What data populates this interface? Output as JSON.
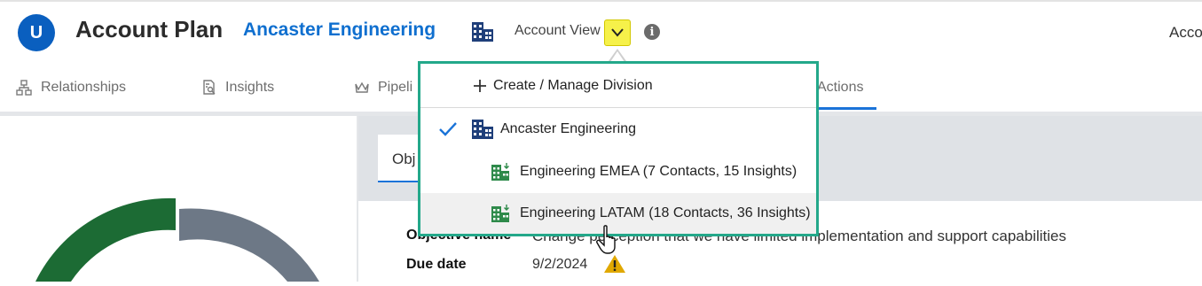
{
  "header": {
    "logo_letter": "U",
    "title": "Account Plan",
    "account_name": "Ancaster Engineering",
    "account_view_label": "Account View",
    "info_symbol": "i",
    "right_truncated_text": "Acco"
  },
  "tabs": [
    {
      "label": "Relationships",
      "icon": "hierarchy-icon"
    },
    {
      "label": "Insights",
      "icon": "insights-icon"
    },
    {
      "label": "Pipeli",
      "icon": "crown-icon"
    },
    {
      "label": "Actions",
      "icon": ""
    }
  ],
  "dropdown": {
    "create_label": "Create / Manage Division",
    "items": [
      {
        "label": "Ancaster Engineering",
        "selected": true
      },
      {
        "label": "Engineering EMEA (7 Contacts, 15 Insights)",
        "selected": false
      },
      {
        "label": "Engineering LATAM (18 Contacts, 36 Insights)",
        "selected": false,
        "hovered": true
      }
    ]
  },
  "objective_tab": {
    "label": "Obj"
  },
  "fields": {
    "objective_name_label": "Objective name",
    "objective_name_value": "Change perception that we have limited implementation and support capabilities",
    "due_date_label": "Due date",
    "due_date_value": "9/2/2024"
  },
  "colors": {
    "brand_blue": "#0a5fbf",
    "link_blue": "#0f6fcf",
    "highlight_yellow": "#f6f14a",
    "dropdown_border": "#23a88a",
    "donut_green": "#1c6b34",
    "donut_gray": "#6d7886",
    "warning": "#e0a800"
  }
}
